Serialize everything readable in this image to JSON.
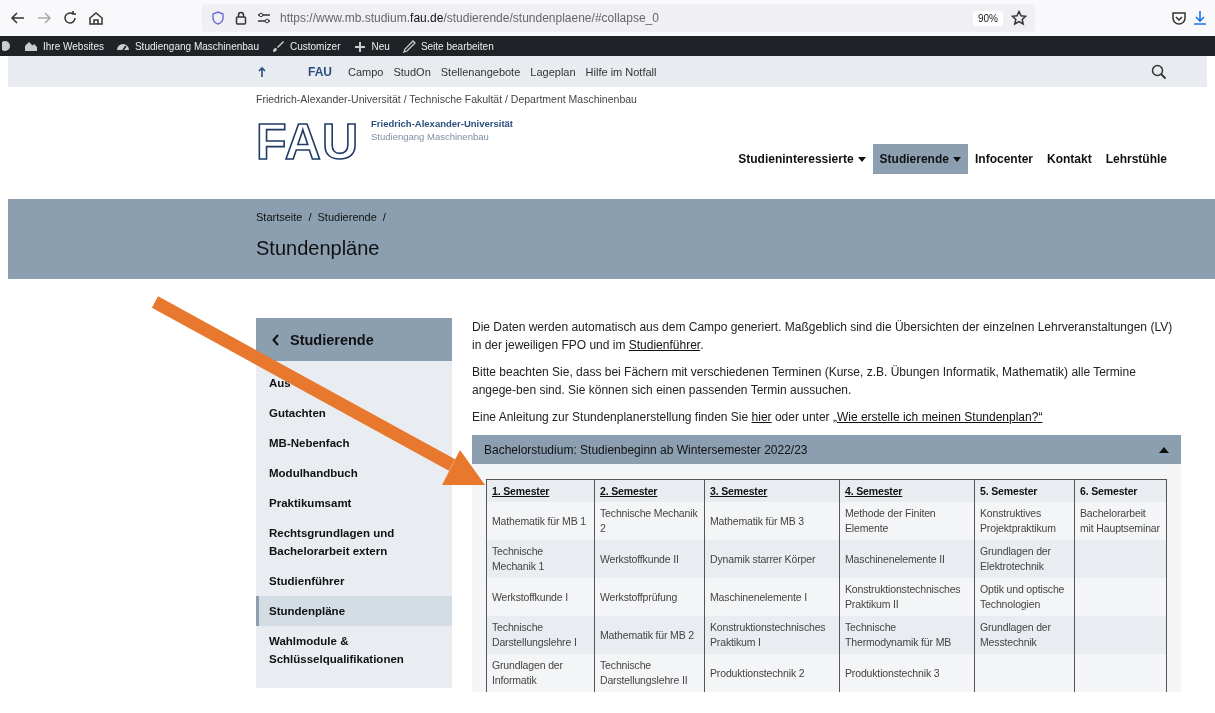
{
  "browser": {
    "url": {
      "prefix": "https://www.mb.studium.",
      "domain": "fau.de",
      "path": "/studierende/stundenplaene/#collapse_0"
    },
    "zoom": "90%"
  },
  "admin_bar": {
    "items": [
      {
        "kind": "sites",
        "label": "Ihre Websites"
      },
      {
        "kind": "dashboard",
        "label": "Studiengang Maschinenbau"
      },
      {
        "kind": "brush",
        "label": "Customizer"
      },
      {
        "kind": "plus",
        "label": "Neu"
      },
      {
        "kind": "pencil",
        "label": "Seite bearbeiten"
      }
    ]
  },
  "meta_nav": {
    "logo": "FAU",
    "links": [
      "Campo",
      "StudOn",
      "Stellenangebote",
      "Lageplan",
      "Hilfe im Notfall"
    ]
  },
  "org_breadcrumb": "Friedrich-Alexander-Universität / Technische Fakultät / Department Maschinenbau",
  "header": {
    "logo": "FAU",
    "university": "Friedrich-Alexander-Universität",
    "program": "Studiengang Maschinenbau",
    "nav": [
      {
        "label": "Studieninteressierte",
        "dropdown": true,
        "selected": false
      },
      {
        "label": "Studierende",
        "dropdown": true,
        "selected": true
      },
      {
        "label": "Infocenter",
        "dropdown": false,
        "selected": false
      },
      {
        "label": "Kontakt",
        "dropdown": false,
        "selected": false
      },
      {
        "label": "Lehrstühle",
        "dropdown": false,
        "selected": false
      }
    ]
  },
  "hero": {
    "breadcrumb": [
      "Startseite",
      "Studierende"
    ],
    "separator": "/",
    "title": "Stundenpläne"
  },
  "sidebar": {
    "title": "Studierende",
    "items": [
      {
        "label": "Aus",
        "selected": false
      },
      {
        "label": "Gutachten",
        "selected": false
      },
      {
        "label": "MB-Nebenfach",
        "selected": false
      },
      {
        "label": "Modulhandbuch",
        "selected": false
      },
      {
        "label": "Praktikumsamt",
        "selected": false
      },
      {
        "label": "Rechtsgrundlagen und Bachelorarbeit extern",
        "selected": false
      },
      {
        "label": "Studienführer",
        "selected": false
      },
      {
        "label": "Stundenpläne",
        "selected": true
      },
      {
        "label": "Wahlmodule & Schlüsselqualifikationen",
        "selected": false
      }
    ]
  },
  "paragraphs": [
    [
      {
        "text": "Die Daten werden automatisch aus dem Campo generiert. Maßgeblich sind die Übersichten der einzelnen Lehrveranstaltungen (LV) in der jeweiligen FPO und im ",
        "link": false
      },
      {
        "text": "Studienführer",
        "link": true
      },
      {
        "text": ".",
        "link": false
      }
    ],
    [
      {
        "text": "Bitte beachten Sie, dass bei Fächern mit verschiedenen Terminen (Kurse, z.B. Übungen Informatik, Mathematik) alle Termine angege-ben sind. Sie können sich einen passenden Termin aussuchen.",
        "link": false
      }
    ],
    [
      {
        "text": "Eine Anleitung zur Stundenplanerstellung finden Sie ",
        "link": false
      },
      {
        "text": "hier",
        "link": true
      },
      {
        "text": " oder unter ",
        "link": false
      },
      {
        "text": "„Wie erstelle ich meinen Stundenplan?“",
        "link": true
      }
    ]
  ],
  "accordion": {
    "title": "Bachelorstudium: Studienbeginn ab Wintersemester 2022/23",
    "expanded": true
  },
  "table": {
    "columns": [
      {
        "label": "1. Semester",
        "underlined": true
      },
      {
        "label": "2. Semester",
        "underlined": true
      },
      {
        "label": "3. Semester",
        "underlined": true
      },
      {
        "label": "4. Semester",
        "underlined": true
      },
      {
        "label": "5. Semester",
        "underlined": false
      },
      {
        "label": "6. Semester",
        "underlined": false
      }
    ],
    "rows": [
      [
        "Mathematik für MB 1",
        "Technische Mechanik 2",
        "Mathematik für MB 3",
        "Methode der Finiten Elemente",
        "Konstruktives Projektpraktikum",
        "Bachelorarbeit mit Hauptseminar"
      ],
      [
        "Technische Mechanik 1",
        "Werkstoffkunde II",
        "Dynamik starrer Körper",
        "Maschinenelemente II",
        "Grundlagen der Elektrotechnik",
        ""
      ],
      [
        "Werkstoffkunde I",
        "Werkstoffprüfung",
        "Maschinenelemente I",
        "Konstruktionstechnisches Praktikum II",
        "Optik und optische Technologien",
        ""
      ],
      [
        "Technische Darstellungslehre I",
        "Mathematik für MB 2",
        "Konstruktionstechnisches Praktikum I",
        "Technische Thermodynamik für MB",
        "Grundlagen der Messtechnik",
        ""
      ],
      [
        "Grundlagen der Informatik",
        "Technische Darstellungslehre II",
        "Produktionstechnik 2",
        "Produktionstechnik 3",
        "",
        ""
      ]
    ]
  }
}
